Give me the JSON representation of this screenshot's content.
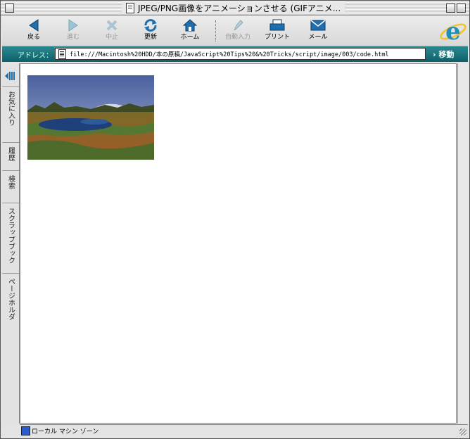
{
  "window": {
    "title": "JPEG/PNG画像をアニメーションさせる (GIFアニメ..."
  },
  "toolbar": {
    "buttons": [
      {
        "label": "戻る",
        "icon": "back-arrow-icon",
        "enabled": true
      },
      {
        "label": "進む",
        "icon": "forward-arrow-icon",
        "enabled": false
      },
      {
        "label": "中止",
        "icon": "stop-x-icon",
        "enabled": false
      },
      {
        "label": "更新",
        "icon": "refresh-icon",
        "enabled": true
      },
      {
        "label": "ホーム",
        "icon": "home-icon",
        "enabled": true
      },
      {
        "label": "自動入力",
        "icon": "autofill-icon",
        "enabled": false
      },
      {
        "label": "プリント",
        "icon": "printer-icon",
        "enabled": true
      },
      {
        "label": "メール",
        "icon": "mail-icon",
        "enabled": true
      }
    ],
    "logo": "internet-explorer-logo"
  },
  "address": {
    "label": "アドレス：",
    "url": "file:///Macintosh%20HDD/本の原稿/JavaScript%20Tips%20&%20Tricks/script/image/003/code.html",
    "go_label": "移動"
  },
  "sidebar": {
    "tabs": [
      "お気に入り",
      "履歴",
      "検索",
      "スクラップブック",
      "ページホルダ"
    ]
  },
  "status": {
    "zone": "ローカル マシン ゾーン"
  },
  "colors": {
    "address_bar": "#1e7880",
    "accent": "#1a8fa0"
  }
}
